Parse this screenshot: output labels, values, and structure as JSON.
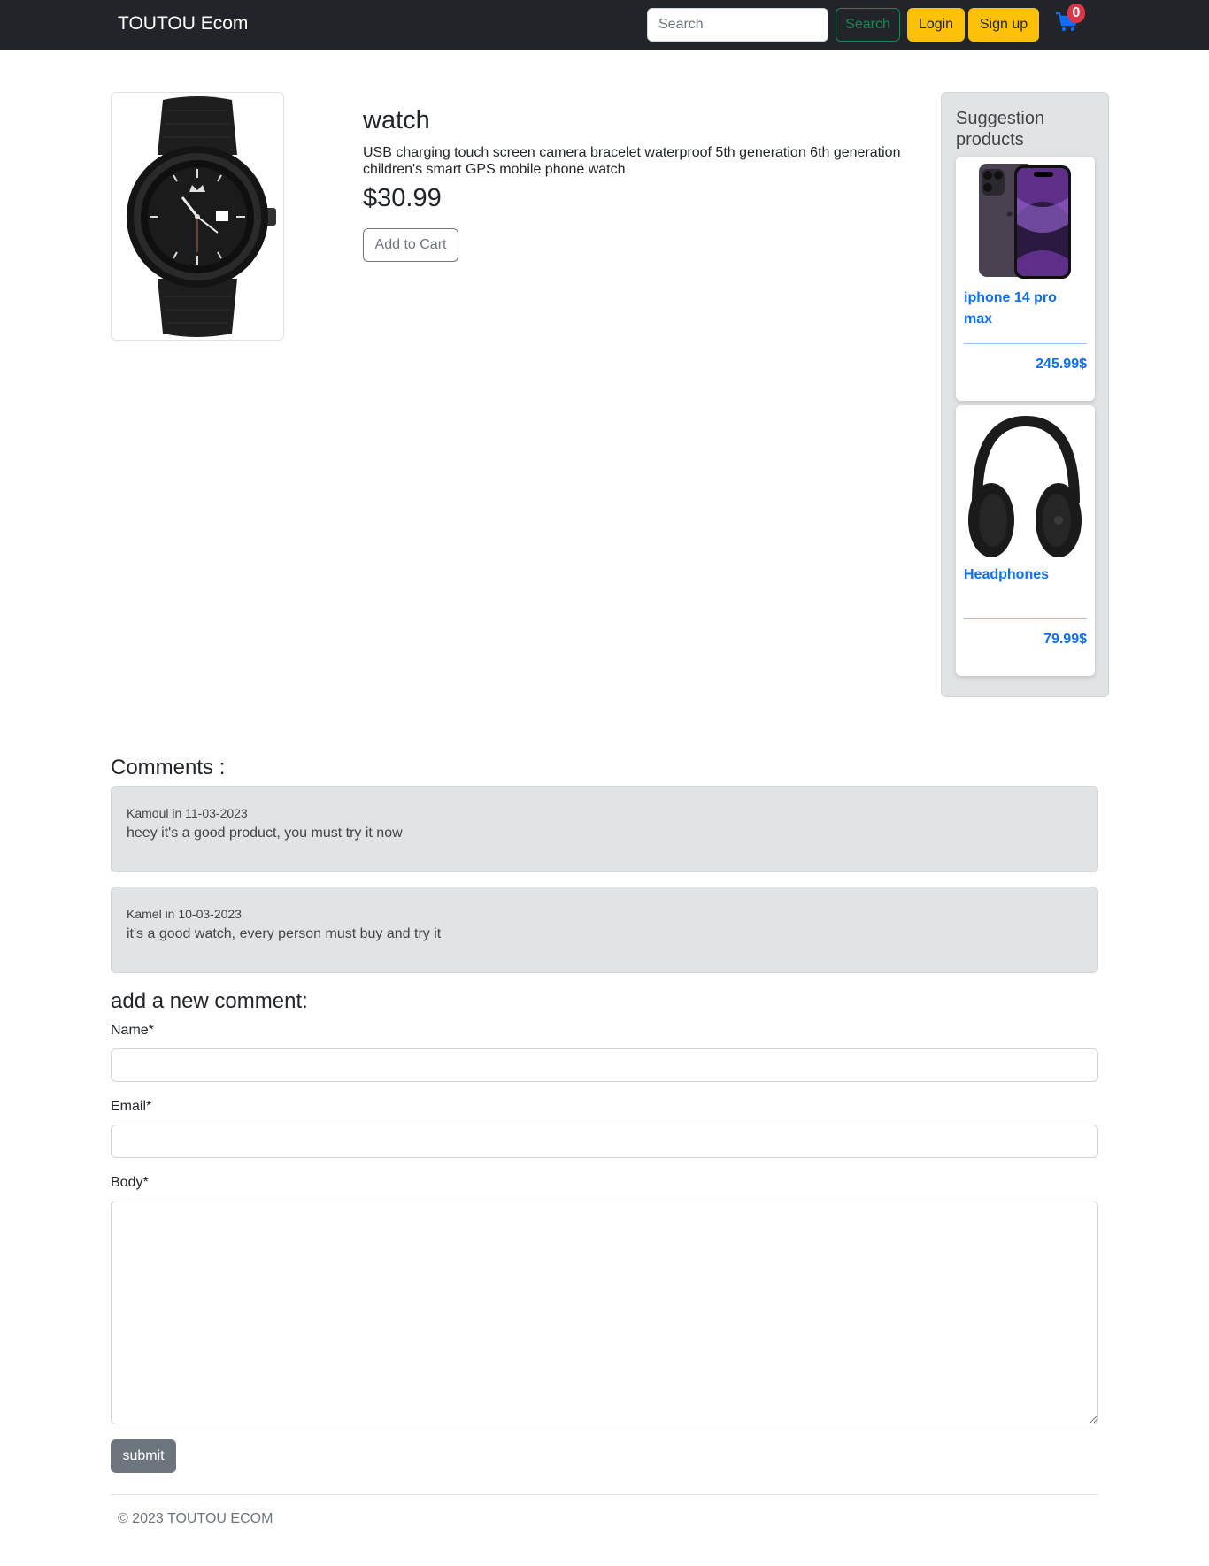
{
  "navbar": {
    "brand": "TOUTOU Ecom",
    "search_placeholder": "Search",
    "search_button": "Search",
    "login": "Login",
    "signup": "Sign up",
    "cart_count": "0"
  },
  "product": {
    "name": "watch",
    "description": "USB charging touch screen camera bracelet waterproof 5th generation 6th generation children's smart GPS mobile phone watch",
    "price": "$30.99",
    "add_to_cart": "Add to Cart",
    "image_icon": "watch-image"
  },
  "suggestions": {
    "title": "Suggestion products",
    "items": [
      {
        "name": "iphone 14 pro max",
        "price": "245.99$",
        "image_icon": "phone-image"
      },
      {
        "name": "Headphones",
        "price": "79.99$",
        "image_icon": "headphones-image"
      }
    ]
  },
  "comments": {
    "heading": "Comments :",
    "items": [
      {
        "meta": "Kamoul in 11-03-2023",
        "body": "heey it's a good product, you must try it now"
      },
      {
        "meta": "Kamel in 10-03-2023",
        "body": "it's a good watch, every person must buy and try it"
      }
    ]
  },
  "form": {
    "heading": "add a new comment:",
    "name_label": "Name*",
    "email_label": "Email*",
    "body_label": "Body*",
    "submit": "submit"
  },
  "footer": {
    "text": "© 2023 TOUTOU ECOM"
  },
  "colors": {
    "navbar_bg": "#212529",
    "accent_yellow": "#ffc107",
    "search_green": "#198754",
    "link_blue": "#0d6efd",
    "panel_gray": "#e2e3e5",
    "badge_red": "#dc3545"
  }
}
